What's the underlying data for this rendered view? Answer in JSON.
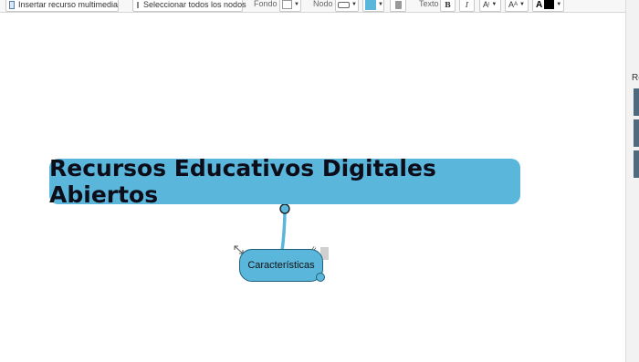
{
  "toolbar": {
    "insert_media": "Insertar recurso multimedia",
    "select_all": "Seleccionar todos los nodos",
    "background_label": "Fondo",
    "node_label": "Nodo",
    "text_label": "Texto",
    "bold": "B",
    "italic": "I",
    "font_size": "A",
    "text_case": "A",
    "font_color": "A",
    "node_fill_color": "#5ab6db",
    "font_color_value": "#000000"
  },
  "right_panel": {
    "title": "Re",
    "accent_color": "#4e6a7e"
  },
  "map": {
    "central_node": "Recursos Educativos Digitales Abiertos",
    "child_node": "Características",
    "node_color": "#5ab6db",
    "link_color": "#5ab6db"
  }
}
